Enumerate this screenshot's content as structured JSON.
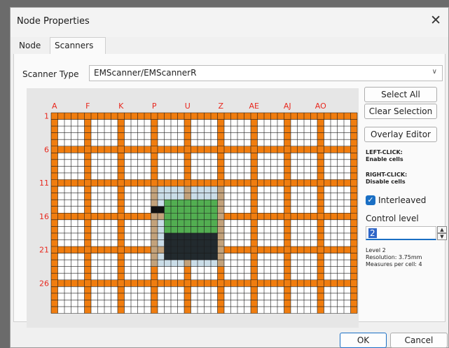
{
  "window": {
    "title": "Node Properties",
    "close_glyph": "✕"
  },
  "tabs": [
    {
      "label": "Node",
      "active": false
    },
    {
      "label": "Scanners",
      "active": true
    }
  ],
  "scanner": {
    "label": "Scanner Type",
    "value": "EMScanner/EMScannerR"
  },
  "grid": {
    "columns": 46,
    "rows": 30,
    "col_labels": [
      "A",
      "F",
      "K",
      "P",
      "U",
      "Z",
      "AE",
      "AJ",
      "AO"
    ],
    "row_labels": [
      "1",
      "6",
      "11",
      "16",
      "21",
      "26"
    ],
    "label_color": "#e8281e",
    "enabled_color": "#f07d0f",
    "cell_color": "#ffffff",
    "line_color": "#1a1a1a",
    "highlight_color": "#5fd05a"
  },
  "buttons": {
    "select_all": "Select All",
    "clear_selection": "Clear Selection",
    "overlay_editor": "Overlay Editor"
  },
  "help": {
    "left_title": "LEFT-CLICK:",
    "left_desc": "Enable cells",
    "right_title": "RIGHT-CLICK:",
    "right_desc": "Disable cells"
  },
  "interleaved": {
    "label": "Interleaved",
    "checked": true
  },
  "control_level": {
    "label": "Control level",
    "value": "2",
    "info_line1": "Level 2",
    "info_line2": "Resolution: 3.75mm",
    "info_line3": "Measures per cell: 4"
  },
  "footer": {
    "ok": "OK",
    "cancel": "Cancel"
  },
  "icons": {
    "check": "checkmark-icon",
    "close": "close-icon",
    "dropdown": "chevron-down-icon"
  }
}
